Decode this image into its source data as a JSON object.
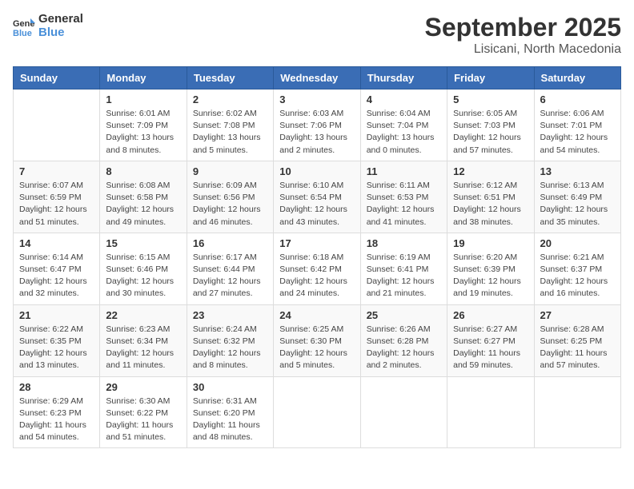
{
  "header": {
    "logo_general": "General",
    "logo_blue": "Blue",
    "month": "September 2025",
    "location": "Lisicani, North Macedonia"
  },
  "weekdays": [
    "Sunday",
    "Monday",
    "Tuesday",
    "Wednesday",
    "Thursday",
    "Friday",
    "Saturday"
  ],
  "weeks": [
    [
      {
        "day": "",
        "info": ""
      },
      {
        "day": "1",
        "info": "Sunrise: 6:01 AM\nSunset: 7:09 PM\nDaylight: 13 hours\nand 8 minutes."
      },
      {
        "day": "2",
        "info": "Sunrise: 6:02 AM\nSunset: 7:08 PM\nDaylight: 13 hours\nand 5 minutes."
      },
      {
        "day": "3",
        "info": "Sunrise: 6:03 AM\nSunset: 7:06 PM\nDaylight: 13 hours\nand 2 minutes."
      },
      {
        "day": "4",
        "info": "Sunrise: 6:04 AM\nSunset: 7:04 PM\nDaylight: 13 hours\nand 0 minutes."
      },
      {
        "day": "5",
        "info": "Sunrise: 6:05 AM\nSunset: 7:03 PM\nDaylight: 12 hours\nand 57 minutes."
      },
      {
        "day": "6",
        "info": "Sunrise: 6:06 AM\nSunset: 7:01 PM\nDaylight: 12 hours\nand 54 minutes."
      }
    ],
    [
      {
        "day": "7",
        "info": "Sunrise: 6:07 AM\nSunset: 6:59 PM\nDaylight: 12 hours\nand 51 minutes."
      },
      {
        "day": "8",
        "info": "Sunrise: 6:08 AM\nSunset: 6:58 PM\nDaylight: 12 hours\nand 49 minutes."
      },
      {
        "day": "9",
        "info": "Sunrise: 6:09 AM\nSunset: 6:56 PM\nDaylight: 12 hours\nand 46 minutes."
      },
      {
        "day": "10",
        "info": "Sunrise: 6:10 AM\nSunset: 6:54 PM\nDaylight: 12 hours\nand 43 minutes."
      },
      {
        "day": "11",
        "info": "Sunrise: 6:11 AM\nSunset: 6:53 PM\nDaylight: 12 hours\nand 41 minutes."
      },
      {
        "day": "12",
        "info": "Sunrise: 6:12 AM\nSunset: 6:51 PM\nDaylight: 12 hours\nand 38 minutes."
      },
      {
        "day": "13",
        "info": "Sunrise: 6:13 AM\nSunset: 6:49 PM\nDaylight: 12 hours\nand 35 minutes."
      }
    ],
    [
      {
        "day": "14",
        "info": "Sunrise: 6:14 AM\nSunset: 6:47 PM\nDaylight: 12 hours\nand 32 minutes."
      },
      {
        "day": "15",
        "info": "Sunrise: 6:15 AM\nSunset: 6:46 PM\nDaylight: 12 hours\nand 30 minutes."
      },
      {
        "day": "16",
        "info": "Sunrise: 6:17 AM\nSunset: 6:44 PM\nDaylight: 12 hours\nand 27 minutes."
      },
      {
        "day": "17",
        "info": "Sunrise: 6:18 AM\nSunset: 6:42 PM\nDaylight: 12 hours\nand 24 minutes."
      },
      {
        "day": "18",
        "info": "Sunrise: 6:19 AM\nSunset: 6:41 PM\nDaylight: 12 hours\nand 21 minutes."
      },
      {
        "day": "19",
        "info": "Sunrise: 6:20 AM\nSunset: 6:39 PM\nDaylight: 12 hours\nand 19 minutes."
      },
      {
        "day": "20",
        "info": "Sunrise: 6:21 AM\nSunset: 6:37 PM\nDaylight: 12 hours\nand 16 minutes."
      }
    ],
    [
      {
        "day": "21",
        "info": "Sunrise: 6:22 AM\nSunset: 6:35 PM\nDaylight: 12 hours\nand 13 minutes."
      },
      {
        "day": "22",
        "info": "Sunrise: 6:23 AM\nSunset: 6:34 PM\nDaylight: 12 hours\nand 11 minutes."
      },
      {
        "day": "23",
        "info": "Sunrise: 6:24 AM\nSunset: 6:32 PM\nDaylight: 12 hours\nand 8 minutes."
      },
      {
        "day": "24",
        "info": "Sunrise: 6:25 AM\nSunset: 6:30 PM\nDaylight: 12 hours\nand 5 minutes."
      },
      {
        "day": "25",
        "info": "Sunrise: 6:26 AM\nSunset: 6:28 PM\nDaylight: 12 hours\nand 2 minutes."
      },
      {
        "day": "26",
        "info": "Sunrise: 6:27 AM\nSunset: 6:27 PM\nDaylight: 11 hours\nand 59 minutes."
      },
      {
        "day": "27",
        "info": "Sunrise: 6:28 AM\nSunset: 6:25 PM\nDaylight: 11 hours\nand 57 minutes."
      }
    ],
    [
      {
        "day": "28",
        "info": "Sunrise: 6:29 AM\nSunset: 6:23 PM\nDaylight: 11 hours\nand 54 minutes."
      },
      {
        "day": "29",
        "info": "Sunrise: 6:30 AM\nSunset: 6:22 PM\nDaylight: 11 hours\nand 51 minutes."
      },
      {
        "day": "30",
        "info": "Sunrise: 6:31 AM\nSunset: 6:20 PM\nDaylight: 11 hours\nand 48 minutes."
      },
      {
        "day": "",
        "info": ""
      },
      {
        "day": "",
        "info": ""
      },
      {
        "day": "",
        "info": ""
      },
      {
        "day": "",
        "info": ""
      }
    ]
  ]
}
